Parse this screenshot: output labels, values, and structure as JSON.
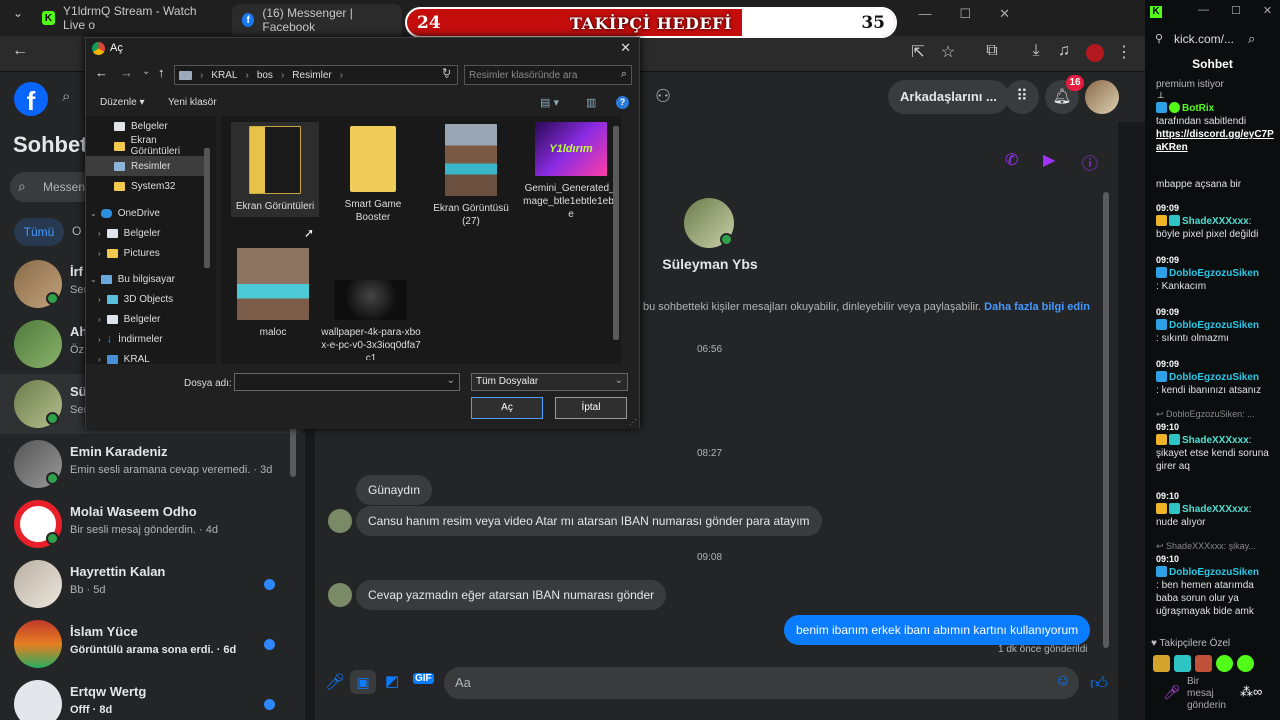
{
  "browser": {
    "tabs": [
      {
        "title": "Y1ldrmQ Stream - Watch Live o"
      },
      {
        "title": "(16) Messenger | Facebook"
      }
    ],
    "side_url": "kick.com/..."
  },
  "goal": {
    "current": "24",
    "label": "TAKİPÇİ HEDEFİ",
    "target": "35",
    "progress": 0.686
  },
  "dialog": {
    "title": "Aç",
    "breadcrumb": [
      "KRAL",
      "bos",
      "Resimler"
    ],
    "search_placeholder": "Resimler klasöründe ara",
    "toolbar": {
      "organize": "Düzenle",
      "new_folder": "Yeni klasör"
    },
    "tree": [
      {
        "label": "Belgeler",
        "type": "doc"
      },
      {
        "label": "Ekran Görüntüleri",
        "type": "folder"
      },
      {
        "label": "Resimler",
        "type": "pic",
        "selected": true
      },
      {
        "label": "System32",
        "type": "folder"
      },
      {
        "label": "OneDrive",
        "type": "cloud"
      },
      {
        "label": "Belgeler",
        "type": "doc"
      },
      {
        "label": "Pictures",
        "type": "folder"
      },
      {
        "label": "Bu bilgisayar",
        "type": "pc"
      },
      {
        "label": "3D Objects",
        "type": "3d"
      },
      {
        "label": "Belgeler",
        "type": "doc"
      },
      {
        "label": "İndirmeler",
        "type": "dl"
      },
      {
        "label": "KRAL",
        "type": "drive"
      }
    ],
    "files": [
      {
        "name": "Ekran Görüntüleri",
        "kind": "folder-dark"
      },
      {
        "name": "Smart Game Booster",
        "kind": "folder"
      },
      {
        "name": "Ekran Görüntüsü (27)",
        "kind": "photo-people"
      },
      {
        "name": "Gemini_Generated_Image_btle1ebtle1ebtle",
        "kind": "photo-neon",
        "thumb_text": "Y1ldırım"
      },
      {
        "name": "maloc",
        "kind": "photo-selfie"
      },
      {
        "name": "wallpaper-4k-para-xbox-e-pc-v0-3x3ioq0dfa7c1",
        "kind": "photo-dark"
      }
    ],
    "filename_label": "Dosya adı:",
    "filename_value": "",
    "filter_value": "Tüm Dosyalar",
    "open_label": "Aç",
    "cancel_label": "İptal"
  },
  "fb": {
    "heading": "Sohbetl",
    "search_placeholder": "Messen",
    "filter_all": "Tümü",
    "friends_btn": "Arkadaşlarını ...",
    "notif_count": "16",
    "conversations": [
      {
        "name": "İrf",
        "sub": "Sen",
        "online": true,
        "unread": false
      },
      {
        "name": "Ah",
        "sub": "Öz",
        "online": false,
        "unread": false
      },
      {
        "name": "Sü",
        "sub": "Sen",
        "online": true,
        "unread": false
      },
      {
        "name": "Emin Karadeniz",
        "sub": "Emin sesli aramana cevap veremedi. · 3d",
        "online": true,
        "unread": false
      },
      {
        "name": "Molai Waseem Odho",
        "sub": "Bir sesli mesaj gönderdin. · 4d",
        "online": true,
        "unread": false
      },
      {
        "name": "Hayrettin Kalan",
        "sub": "Bb · 5d",
        "online": false,
        "unread": true
      },
      {
        "name": "İslam Yüce",
        "sub": "Görüntülü arama sona erdi. · 6d",
        "online": false,
        "unread": true
      },
      {
        "name": "Ertqw Wertg",
        "sub": "Offf · 8d",
        "online": false,
        "unread": true
      }
    ],
    "chat": {
      "contact": "Süleyman Ybs",
      "privacy_text": "bu sohbetteki kişiler mesajları okuyabilir, dinleyebilir veya paylaşabilir.",
      "privacy_link": "Daha fazla bilgi edin",
      "messages": [
        {
          "kind": "time",
          "text": "06:56"
        },
        {
          "kind": "time",
          "text": "08:27"
        },
        {
          "kind": "in",
          "text": "Günaydın"
        },
        {
          "kind": "in",
          "text": "Cansu hanım resim veya video Atar mı atarsan IBAN numarası gönder para atayım"
        },
        {
          "kind": "time",
          "text": "09:08"
        },
        {
          "kind": "in",
          "text": "Cevap yazmadın eğer atarsan IBAN numarası gönder"
        },
        {
          "kind": "out",
          "text": "benim ibanım erkek ibanı abımın kartını kullanıyorum"
        }
      ],
      "sent_status": "1 dk önce gönderildi",
      "input_placeholder": "Aa"
    }
  },
  "kick": {
    "title": "Sohbet",
    "top_msg": "premium istiyor",
    "pinned": {
      "user": "BotRix",
      "text": "tarafından sabitlendi",
      "link": "https://discord.gg/eyC7PaKRen"
    },
    "cont": "mbappe açsana bir",
    "messages": [
      {
        "time": "09:09",
        "user": "ShadeXXXxxx",
        "text": "böyle pixel pixel değildi"
      },
      {
        "time": "09:09",
        "user": "DobloEgzozuSiken",
        "text": "Kankacım"
      },
      {
        "time": "09:09",
        "user": "DobloEgzozuSiken",
        "text": "sıkıntı olmazmı"
      },
      {
        "time": "09:09",
        "user": "DobloEgzozuSiken",
        "text": "kendi ibanınızı atsanız"
      },
      {
        "reply": "DobloEgzozuSiken: ...",
        "time": "09:10",
        "user": "ShadeXXXxxx",
        "text": "şikayet etse kendi soruna girer aq"
      },
      {
        "time": "09:10",
        "user": "ShadeXXXxxx",
        "text": "nude alıyor"
      },
      {
        "reply": "ShadeXXXxxx: şikay...",
        "time": "09:10",
        "user": "DobloEgzozuSiken",
        "text": "ben hemen atarımda baba sorun olur ya uğraşmayak bide amk"
      }
    ],
    "followers_label": "Takipçilere Özel",
    "input_placeholder": "Bir mesaj gönderin"
  },
  "colors": {
    "fb_blue": "#0a7cff",
    "online": "#31a24c",
    "kick_green": "#53fc18",
    "goal_red": "#c40d0d"
  }
}
